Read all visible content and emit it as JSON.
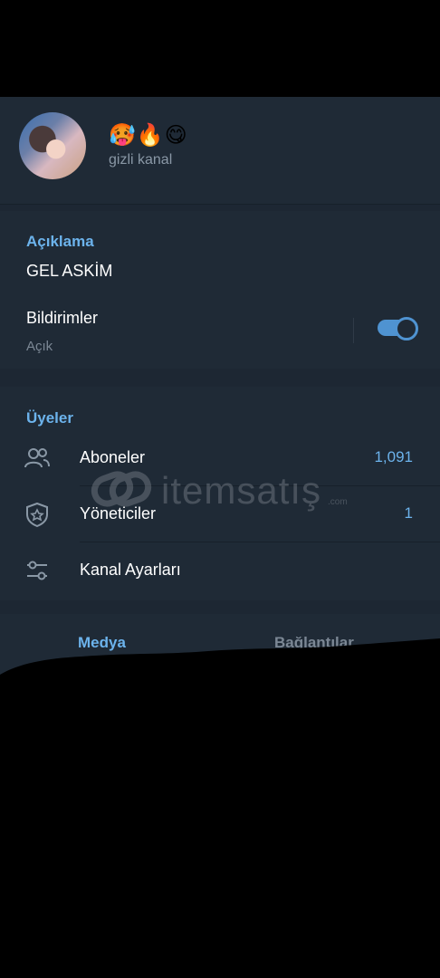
{
  "header": {
    "channel_emojis": "🥵🔥😋",
    "channel_subtitle": "gizli kanal"
  },
  "description": {
    "title": "Açıklama",
    "text": "GEL ASKİM"
  },
  "notifications": {
    "label": "Bildirimler",
    "state": "Açık",
    "enabled": true
  },
  "members": {
    "title": "Üyeler",
    "rows": [
      {
        "label": "Aboneler",
        "value": "1,091",
        "icon": "people-icon"
      },
      {
        "label": "Yöneticiler",
        "value": "1",
        "icon": "shield-star-icon"
      },
      {
        "label": "Kanal Ayarları",
        "value": "",
        "icon": "sliders-icon"
      }
    ]
  },
  "watermark": {
    "text": "itemsatış",
    "suffix": ".com"
  },
  "tabs": [
    {
      "label": "Medya",
      "active": true
    },
    {
      "label": "Bağlantılar",
      "active": false
    }
  ],
  "colors": {
    "background": "#1d2733",
    "section": "#1f2a36",
    "accent": "#6cb3ec",
    "toggle": "#4f93d1",
    "text": "#ffffff",
    "muted": "#7b8794"
  }
}
